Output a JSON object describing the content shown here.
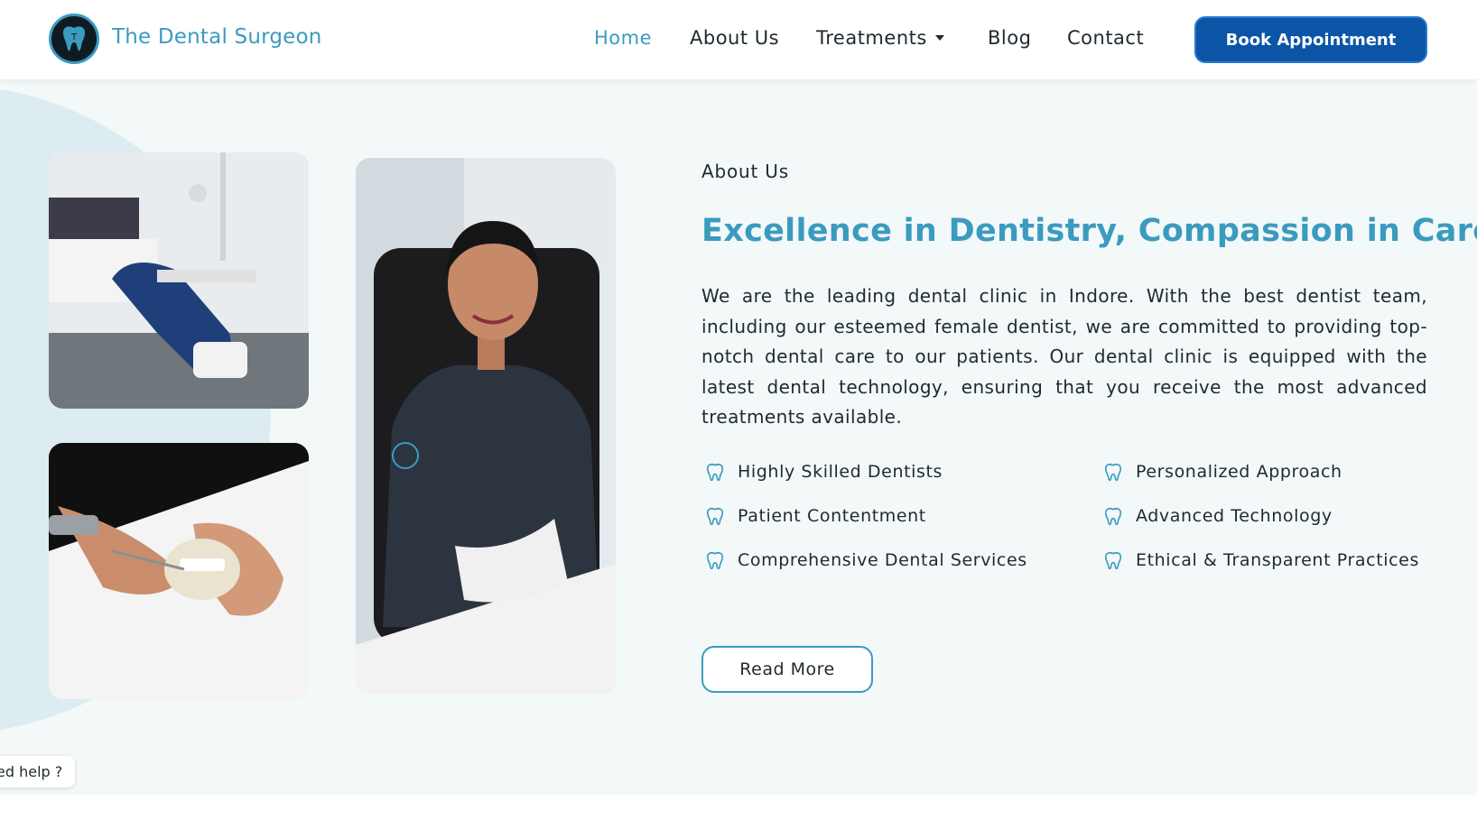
{
  "brand": {
    "name": "The Dental Surgeon",
    "logo_icon": "tooth-logo-icon"
  },
  "nav": {
    "home": "Home",
    "about": "About  Us",
    "treatments": "Treatments",
    "blog": "Blog",
    "contact": "Contact"
  },
  "header": {
    "cta": "Book Appointment"
  },
  "about": {
    "eyebrow": "About  Us",
    "headline": "Excellence in Dentistry, Compassion in Care",
    "paragraph": "We are the leading dental clinic in Indore. With the best dentist team, including our esteemed female dentist, we are committed to providing top-notch dental care to our patients. Our dental clinic is equipped with the latest dental technology, ensuring that you receive the most advanced treatments available.",
    "features": [
      "Highly Skilled Dentists",
      "Personalized Approach",
      "Patient Contentment",
      "Advanced Technology",
      "Comprehensive Dental Services",
      "Ethical & Transparent Practices"
    ],
    "read_more": "Read More"
  },
  "help_widget": {
    "label": "ed help ?"
  },
  "colors": {
    "accent": "#3b9bbf",
    "cta": "#0c55a6",
    "section_bg": "#f3f8f9",
    "text": "#1f2a30"
  }
}
